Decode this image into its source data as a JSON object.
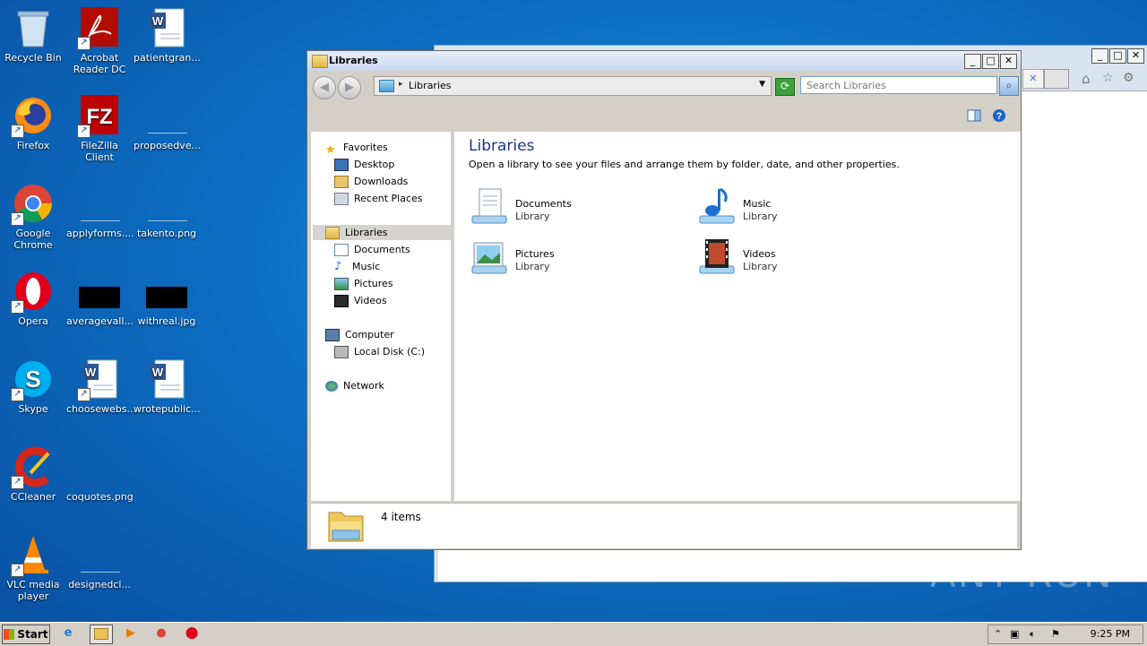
{
  "desktop": {
    "icons": [
      {
        "label": "Recycle Bin"
      },
      {
        "label": "Acrobat Reader DC"
      },
      {
        "label": "patientgran..."
      },
      {
        "label": "Firefox"
      },
      {
        "label": "FileZilla Client"
      },
      {
        "label": "proposedve..."
      },
      {
        "label": "Google Chrome"
      },
      {
        "label": "applyforms...."
      },
      {
        "label": "takento.png"
      },
      {
        "label": "Opera"
      },
      {
        "label": "averagevall..."
      },
      {
        "label": "withreal.jpg"
      },
      {
        "label": "Skype"
      },
      {
        "label": "choosewebs..."
      },
      {
        "label": "wrotepublic..."
      },
      {
        "label": "CCleaner"
      },
      {
        "label": "coquotes.png"
      },
      {
        "label": "VLC media player"
      },
      {
        "label": "designedcl..."
      }
    ]
  },
  "explorer": {
    "title": "Libraries",
    "address": "Libraries",
    "search_placeholder": "Search Libraries",
    "nav": {
      "favorites": "Favorites",
      "desktop": "Desktop",
      "downloads": "Downloads",
      "recent": "Recent Places",
      "libraries": "Libraries",
      "documents": "Documents",
      "music": "Music",
      "pictures": "Pictures",
      "videos": "Videos",
      "computer": "Computer",
      "localdisk": "Local Disk (C:)",
      "network": "Network"
    },
    "heading": "Libraries",
    "description": "Open a library to see your files and arrange them by folder, date, and other properties.",
    "libraries": [
      {
        "name": "Documents",
        "sub": "Library"
      },
      {
        "name": "Music",
        "sub": "Library"
      },
      {
        "name": "Pictures",
        "sub": "Library"
      },
      {
        "name": "Videos",
        "sub": "Library"
      }
    ],
    "status": "4 items"
  },
  "taskbar": {
    "start": "Start",
    "clock": "9:25 PM"
  },
  "watermark": "ANY RUN",
  "colors": {
    "desktop": "#0c6fc4",
    "heading": "#1e3287",
    "window_chrome": "#d4d0c8"
  }
}
